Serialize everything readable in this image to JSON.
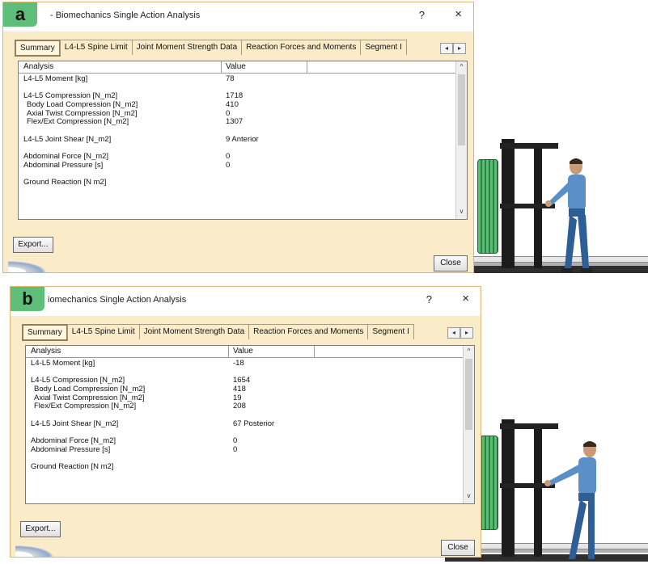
{
  "panels": [
    {
      "letter": "a",
      "title": "- Biomechanics Single Action Analysis",
      "help": "?",
      "close_glyph": "×",
      "tabs": [
        "Summary",
        "L4-L5 Spine Limit",
        "Joint Moment Strength Data",
        "Reaction Forces and Moments",
        "Segment I"
      ],
      "active_tab": "Summary",
      "grid_headers": {
        "analysis": "Analysis",
        "value": "Value"
      },
      "rows": [
        {
          "label": "L4-L5 Moment [kg]",
          "value": "78",
          "indent": false
        },
        {
          "label": "",
          "value": "",
          "indent": false
        },
        {
          "label": "L4-L5 Compression [N_m2]",
          "value": "1718",
          "indent": false
        },
        {
          "label": "Body Load Compression [N_m2]",
          "value": "410",
          "indent": true
        },
        {
          "label": "Axial Twist Compression [N_m2]",
          "value": "0",
          "indent": true
        },
        {
          "label": "Flex/Ext Compression [N_m2]",
          "value": "1307",
          "indent": true
        },
        {
          "label": "",
          "value": "",
          "indent": false
        },
        {
          "label": "L4-L5 Joint Shear [N_m2]",
          "value": "9  Anterior",
          "indent": false
        },
        {
          "label": "",
          "value": "",
          "indent": false
        },
        {
          "label": "Abdominal Force [N_m2]",
          "value": "0",
          "indent": false
        },
        {
          "label": "Abdominal Pressure [s]",
          "value": "0",
          "indent": false
        },
        {
          "label": "",
          "value": "",
          "indent": false
        },
        {
          "label": "Ground Reaction [N m2]",
          "value": "",
          "indent": false
        }
      ],
      "export_label": "Export...",
      "close_label": "Close",
      "icons": [
        "chevron-up-icon",
        "chevron-down-icon",
        "tab-scroll-left-icon",
        "tab-scroll-right-icon"
      ]
    },
    {
      "letter": "b",
      "title": "iomechanics Single Action Analysis",
      "help": "?",
      "close_glyph": "×",
      "tabs": [
        "Summary",
        "L4-L5 Spine Limit",
        "Joint Moment Strength Data",
        "Reaction Forces and Moments",
        "Segment I"
      ],
      "active_tab": "Summary",
      "grid_headers": {
        "analysis": "Analysis",
        "value": "Value"
      },
      "rows": [
        {
          "label": "L4-L5 Moment [kg]",
          "value": "-18",
          "indent": false
        },
        {
          "label": "",
          "value": "",
          "indent": false
        },
        {
          "label": "L4-L5 Compression [N_m2]",
          "value": "1654",
          "indent": false
        },
        {
          "label": "Body Load Compression [N_m2]",
          "value": "418",
          "indent": true
        },
        {
          "label": "Axial Twist Compression [N_m2]",
          "value": "19",
          "indent": true
        },
        {
          "label": "Flex/Ext Compression [N_m2]",
          "value": "208",
          "indent": true
        },
        {
          "label": "",
          "value": "",
          "indent": false
        },
        {
          "label": "L4-L5 Joint Shear [N_m2]",
          "value": "67  Posterior",
          "indent": false
        },
        {
          "label": "",
          "value": "",
          "indent": false
        },
        {
          "label": "Abdominal Force [N_m2]",
          "value": "0",
          "indent": false
        },
        {
          "label": "Abdominal Pressure [s]",
          "value": "0",
          "indent": false
        },
        {
          "label": "",
          "value": "",
          "indent": false
        },
        {
          "label": "Ground Reaction [N m2]",
          "value": "",
          "indent": false
        }
      ],
      "export_label": "Export...",
      "close_label": "Close",
      "icons": [
        "chevron-up-icon",
        "chevron-down-icon",
        "tab-scroll-left-icon",
        "tab-scroll-right-icon"
      ]
    }
  ],
  "colors": {
    "dialog_bg": "#fbecc9",
    "panel_letter_bg": "#5fbe7a",
    "plate_green": "#3fa45a",
    "worker_shirt": "#5b8fc8",
    "worker_pants": "#2d5f96"
  }
}
